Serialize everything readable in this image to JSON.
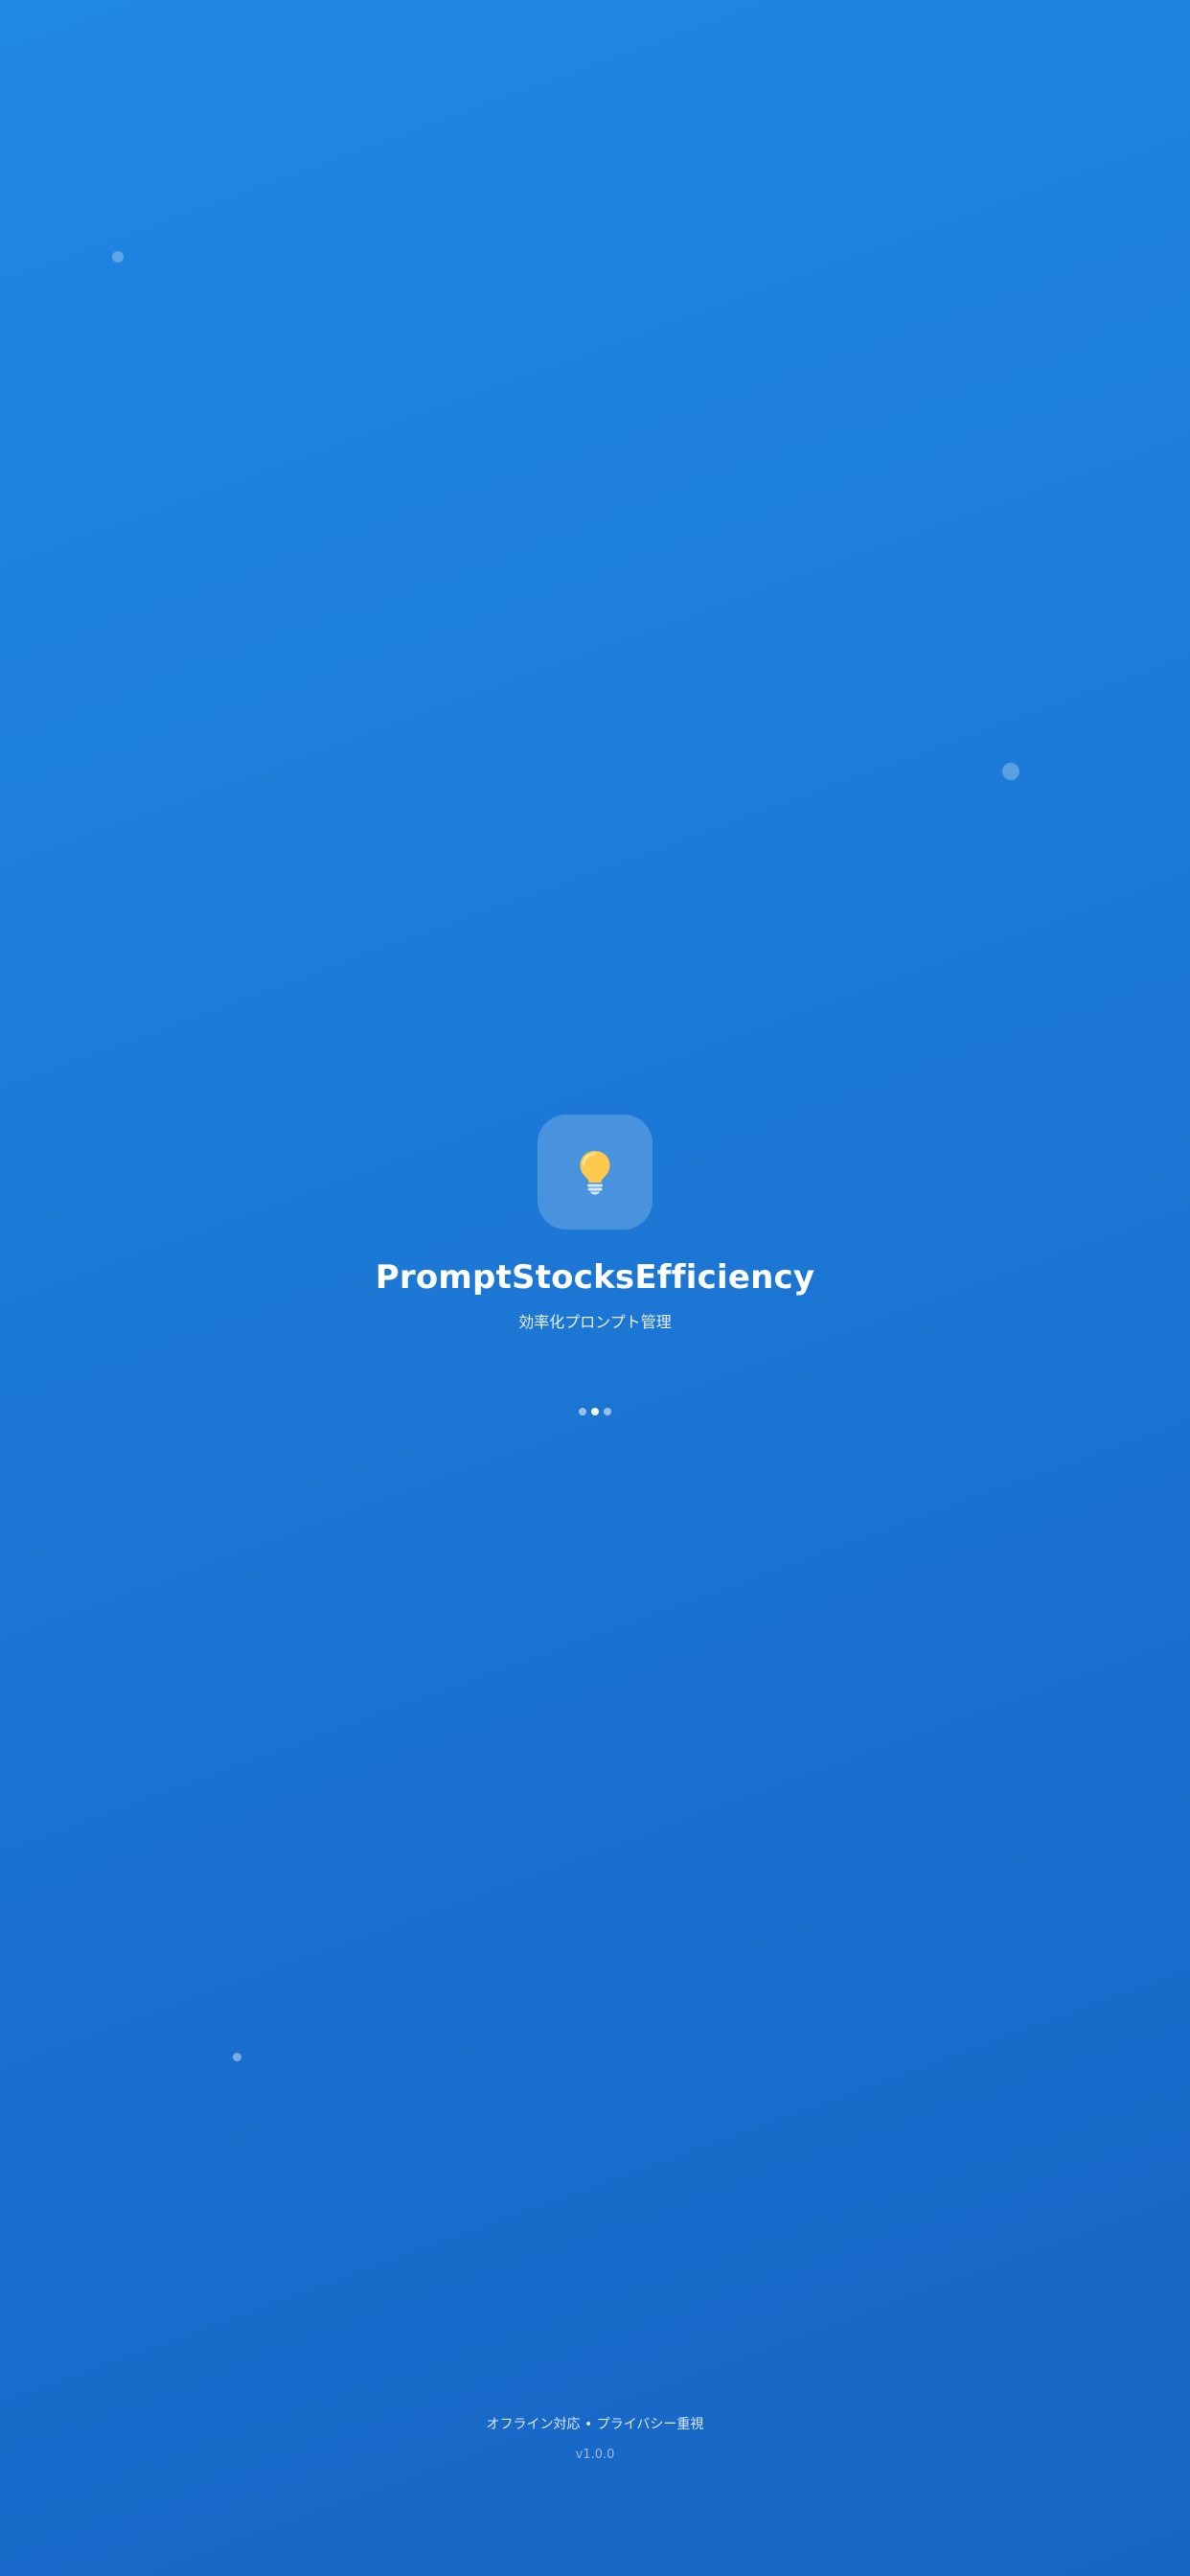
{
  "app": {
    "name": "PromptStocksEfficiency",
    "tagline": "効率化プロンプト管理",
    "logo_icon": "lightbulb-icon"
  },
  "loading": {
    "dot_count": 3,
    "active_dot": 2
  },
  "footer": {
    "features": "オフライン対応 • プライバシー重視",
    "version": "v1.0.0"
  },
  "colors": {
    "background_start": "#1f88e3",
    "background_end": "#1764c4",
    "bulb": "#ffc94d"
  }
}
